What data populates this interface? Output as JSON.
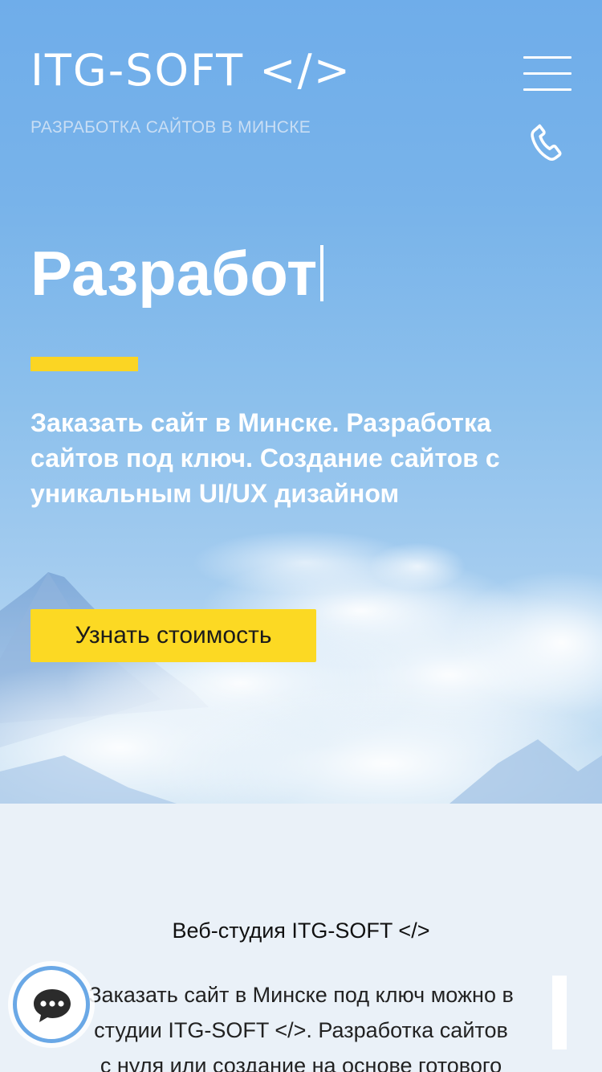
{
  "header": {
    "logo": "ITG-SOFT </>",
    "tagline": "РАЗРАБОТКА САЙТОВ В МИНСКЕ",
    "menu_icon": "hamburger-menu-icon",
    "phone_icon": "phone-icon"
  },
  "hero": {
    "headline": "Разработ",
    "subtitle": "Заказать сайт в Минске. Разработка сайтов под ключ. Создание сайтов с уникальным UI/UX дизайном",
    "cta_label": "Узнать стоимость"
  },
  "about": {
    "title": "Веб-студия ITG-SOFT </>",
    "text_lines": [
      "Заказать сайт в Минске под ключ можно в",
      "студии ITG-SOFT </>. Разработка сайтов",
      "с нуля или создание на основе готового"
    ]
  },
  "chat": {
    "icon": "chat-bubble-icon"
  },
  "colors": {
    "accent": "#fbd523",
    "sky_top": "#6fadea",
    "section_bg": "#eaf1f8",
    "chat_ring": "#6aa8e6"
  }
}
